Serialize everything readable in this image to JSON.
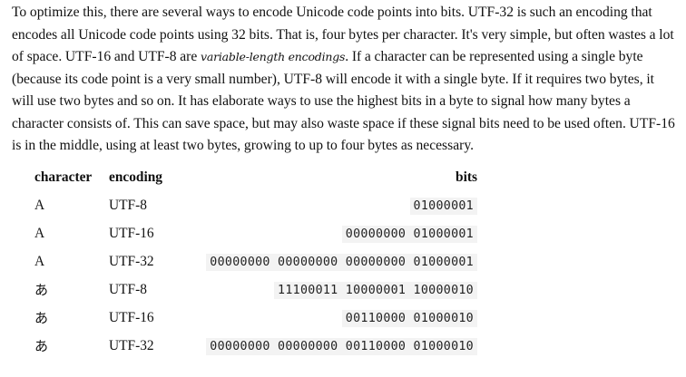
{
  "paragraph": {
    "part1": "To optimize this, there are several ways to encode Unicode code points into bits. UTF-32 is such an encoding that encodes all Unicode code points using 32 bits. That is, four bytes per character. It's very simple, but often wastes a lot of space. UTF-16 and UTF-8 are ",
    "emphasis": "variable-length encodings",
    "part2": ". If a character can be represented using a single byte (because its code point is a very small number), UTF-8 will encode it with a single byte. If it requires two bytes, it will use two bytes and so on. It has elaborate ways to use the highest bits in a byte to signal how many bytes a character consists of. This can save space, but may also waste space if these signal bits need to be used often. UTF-16 is in the middle, using at least two bytes, growing to up to four bytes as necessary."
  },
  "table": {
    "headers": {
      "character": "character",
      "encoding": "encoding",
      "bits": "bits"
    },
    "rows": [
      {
        "character": "A",
        "encoding": "UTF-8",
        "bits": "01000001"
      },
      {
        "character": "A",
        "encoding": "UTF-16",
        "bits": "00000000 01000001"
      },
      {
        "character": "A",
        "encoding": "UTF-32",
        "bits": "00000000 00000000 00000000 01000001"
      },
      {
        "character": "あ",
        "encoding": "UTF-8",
        "bits": "11100011 10000001 10000010"
      },
      {
        "character": "あ",
        "encoding": "UTF-16",
        "bits": "00110000 01000010"
      },
      {
        "character": "あ",
        "encoding": "UTF-32",
        "bits": "00000000 00000000 00110000 01000010"
      }
    ]
  }
}
